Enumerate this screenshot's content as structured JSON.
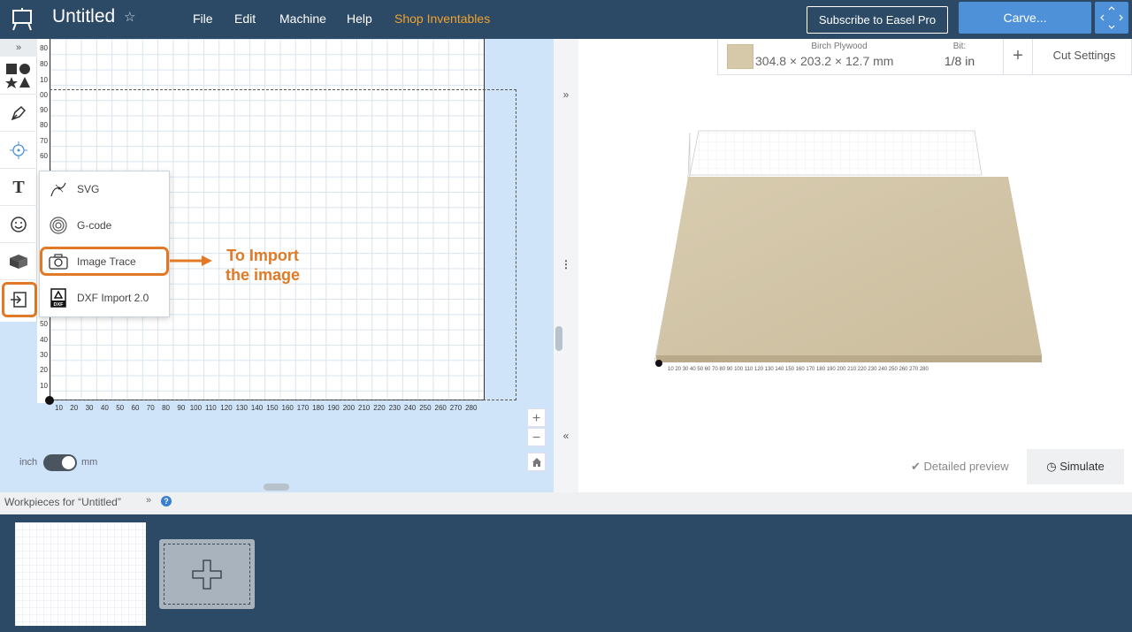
{
  "header": {
    "title": "Untitled",
    "menus": [
      "File",
      "Edit",
      "Machine",
      "Help",
      "Shop Inventables"
    ],
    "subscribe_label": "Subscribe to Easel Pro",
    "carve_label": "Carve..."
  },
  "toolbar": {
    "tools": [
      "shapes-icon",
      "pen-icon",
      "target-icon",
      "text-icon",
      "emoji-icon",
      "3d-box-icon",
      "import-icon"
    ]
  },
  "canvas": {
    "ruler_y": [
      "80",
      "70",
      "60",
      "50",
      "40",
      "30",
      "20",
      "10",
      "90",
      "80",
      "70",
      "60",
      "50",
      "40",
      "30",
      "20",
      "10"
    ],
    "ruler_x": [
      "10",
      "20",
      "30",
      "40",
      "50",
      "60",
      "70",
      "80",
      "90",
      "100",
      "110",
      "120",
      "130",
      "140",
      "150",
      "160",
      "170",
      "180",
      "190",
      "200",
      "210",
      "220",
      "230",
      "240",
      "250",
      "260",
      "270",
      "280"
    ],
    "unit_left": "inch",
    "unit_right": "mm"
  },
  "import_menu": {
    "items": [
      {
        "label": "SVG",
        "icon": "svg-icon"
      },
      {
        "label": "G-code",
        "icon": "gcode-icon"
      },
      {
        "label": "Image Trace",
        "icon": "camera-icon"
      },
      {
        "label": "DXF Import 2.0",
        "icon": "dxf-icon"
      }
    ]
  },
  "annotation": {
    "line1": "To Import",
    "line2": "the image",
    "color": "#e07a26"
  },
  "material": {
    "name": "Birch Plywood",
    "dims": "304.8 × 203.2 × 12.7 mm",
    "bit_label": "Bit:",
    "bit_value": "1/8 in",
    "cut_settings": "Cut Settings"
  },
  "preview": {
    "detailed_label": "Detailed preview",
    "simulate_label": "Simulate"
  },
  "workpieces": {
    "label": "Workpieces for “Untitled”"
  },
  "colors": {
    "header_bg": "#2c4a66",
    "accent_blue": "#4e91d8",
    "shop_orange": "#f0a22e"
  }
}
